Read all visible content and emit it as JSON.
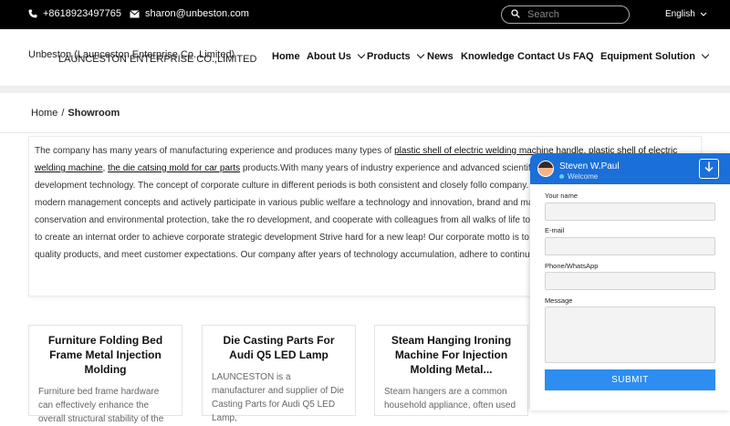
{
  "topbar": {
    "phone": "+8618923497765",
    "email": "sharon@unbeston.com",
    "search_placeholder": "Search",
    "language": "English"
  },
  "header": {
    "logo_alt": "Unbeston (Launceston Enterprise Co.,Limited)",
    "logo_text": "LAUNCESTON ENTERPRISE CO.,LIMITED",
    "nav": [
      {
        "label": "Home",
        "dropdown": false
      },
      {
        "label": "About Us",
        "dropdown": true
      },
      {
        "label": "Products",
        "dropdown": true
      },
      {
        "label": "News",
        "dropdown": false
      },
      {
        "label": "Knowledge",
        "dropdown": false
      },
      {
        "label": "Contact Us",
        "dropdown": false
      },
      {
        "label": "FAQ",
        "dropdown": false
      },
      {
        "label": "Equipment",
        "dropdown": false
      },
      {
        "label": "Solution",
        "dropdown": true
      }
    ]
  },
  "breadcrumb": {
    "home": "Home",
    "separator": "/",
    "current": "Showroom"
  },
  "intro": {
    "p1": "The company has many years of manufacturing experience and produces many types of ",
    "link1": "plastic shell of electric welding machine handle",
    "sep1": ", ",
    "link2": "plastic shell of electric welding machine",
    "sep2": ", ",
    "link3": "the die catsing mold for car parts",
    "p2": " products.With many years of industry experience and advanced scientific research ad Injection Mold development technology. The concept of corporate culture in different periods is both consistent and closely follo company. We insist on guiding employees with modern management concepts and actively participate in various public welfare a technology and innovation, brand and market, talents and teams, energy conservation and environmental protection, take the ro development, and cooperate with colleagues from all walks of life to develop and cooperate with each other to create an internat order to achieve corporate strategic development Strive hard for a new leap! Our corporate motto is to build a harmonious orga manufacture quality products, and meet customer expectations. Our company after years of technology accumulation, adhere to continuous innovation."
  },
  "products": [
    {
      "title": "Furniture Folding Bed Frame Metal Injection Molding",
      "desc": "Furniture bed frame hardware can effectively enhance the overall structural stability of the"
    },
    {
      "title": "Die Casting Parts For Audi Q5 LED Lamp",
      "desc": "LAUNCESTON is a manufacturer and supplier of Die Casting Parts for Audi Q5 LED Lamp,"
    },
    {
      "title": "Steam Hanging Ironing Machine For Injection Molding Metal...",
      "desc": "Steam hangers are a common household appliance, often used"
    }
  ],
  "chat": {
    "agent_name": "Steven W.Paul",
    "status": "Welcome",
    "name_label": "Your name",
    "email_label": "E-mail",
    "phone_label": "Phone/WhatsApp",
    "message_label": "Message",
    "submit_label": "SUBMIT"
  },
  "colors": {
    "topbar_bg": "#000000",
    "chat_header": "#1b6fd8",
    "submit_button": "#2e8df0"
  }
}
